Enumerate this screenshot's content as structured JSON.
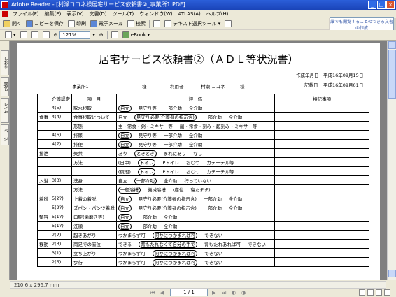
{
  "window": {
    "title": "Adobe Reader - [村瀬ココネ様居宅サービス依頼書②_事業所1.PDF]",
    "min": "_",
    "max": "□",
    "close": "×"
  },
  "menu": [
    "ファイル(F)",
    "編集(E)",
    "表示(V)",
    "文書(D)",
    "ツール(T)",
    "ウィンドウ(W)",
    "ATLAS(A)",
    "ヘルプ(H)"
  ],
  "toolbar1": {
    "open": "開く",
    "save_copy": "コピーを保存",
    "print": "印刷",
    "email": "電子メール",
    "search": "検索",
    "text_select": "テキスト選択ツール"
  },
  "help_box": "誰でも閲覧することのできる文書の作成",
  "toolbar2": {
    "zoom": "121%",
    "ebook": "eBook"
  },
  "nav_tabs": [
    "しおり",
    "署名",
    "レイヤー",
    "ページ"
  ],
  "status": {
    "page_size": "210.6 x 296.7 mm",
    "page_display": "1 / 1"
  },
  "document": {
    "title": "居宅サービス依頼書②（ＡＤＬ等状況書）",
    "created_label": "作成年月日",
    "created_date": "平成16年09月15日",
    "recorded_label": "記載日",
    "recorded_date": "平成16年09月01日",
    "office": "事業所1",
    "sama1": "様",
    "user_label": "利用者",
    "user_name": "村瀬 ココネ",
    "sama2": "様",
    "headers": {
      "cert": "介護認定",
      "item": "項　目",
      "eval": "評　価",
      "notes": "特記事項"
    },
    "rows": [
      {
        "cat": "",
        "cert": "4(5)",
        "item": "飲水摂取",
        "vals": [
          "自立",
          "見守り等",
          "一部介助",
          "全介助"
        ],
        "sel": 0
      },
      {
        "cat": "食事",
        "cert": "4(4)",
        "item": "食事摂取について",
        "vals": [
          "自立",
          "見守り必要(介護者の指示含)",
          "一部介助",
          "全介助"
        ],
        "sel": 1
      },
      {
        "cat": "",
        "cert": "",
        "item": "形態",
        "vals": [
          "主・常食・粥・ミキサー等",
          "副・常食・刻み・超刻み・ミキサー等"
        ],
        "sel": -1
      },
      {
        "cat": "",
        "cert": "4(6)",
        "item": "排尿",
        "vals": [
          "自立",
          "見守り等",
          "一部介助",
          "全介助"
        ],
        "sel": 0
      },
      {
        "cat": "",
        "cert": "4(7)",
        "item": "排便",
        "vals": [
          "自立",
          "見守り等",
          "一部介助",
          "全介助"
        ],
        "sel": 0
      },
      {
        "cat": "排泄",
        "cert": "",
        "item": "失禁",
        "vals": [
          "あり",
          "ときどき",
          "まれにあり",
          "なし"
        ],
        "sel": 1
      },
      {
        "cat": "",
        "cert": "",
        "item": "方法",
        "vals": [
          "(日中)",
          "トイレ",
          "Pトイレ",
          "おむつ",
          "カテーテル等"
        ],
        "sel": 1
      },
      {
        "cat": "",
        "cert": "",
        "item": "",
        "vals": [
          "(夜間)",
          "トイレ",
          "Pトイレ",
          "おむつ",
          "カテーテル等"
        ],
        "sel": 1
      },
      {
        "cat": "入浴",
        "cert": "3(3)",
        "item": "洗身",
        "vals": [
          "自立",
          "一部介助",
          "全介助",
          "行っていない"
        ],
        "sel": 1
      },
      {
        "cat": "",
        "cert": "",
        "item": "方法",
        "vals": [
          "一般浴槽",
          "機械浴槽",
          "(座位",
          "寝たまま)"
        ],
        "sel": 0
      },
      {
        "cat": "着脱",
        "cert": "5(2?)",
        "item": "上着の着脱",
        "vals": [
          "自立",
          "見守り必要(介護者の指示含)",
          "一部介助",
          "全介助"
        ],
        "sel": 0
      },
      {
        "cat": "",
        "cert": "5(2?)",
        "item": "ズボン・パンツ着脱",
        "vals": [
          "自立",
          "見守り必要(介護者の指示含)",
          "一部介助",
          "全介助"
        ],
        "sel": 0
      },
      {
        "cat": "整容",
        "cert": "5(1?)",
        "item": "口腔(歯磨き等)",
        "vals": [
          "自立",
          "一部介助",
          "全介助"
        ],
        "sel": 0
      },
      {
        "cat": "",
        "cert": "5(1?)",
        "item": "洗顔",
        "vals": [
          "自立",
          "一部介助",
          "全介助"
        ],
        "sel": 0
      },
      {
        "cat": "",
        "cert": "2(2)",
        "item": "起きあがり",
        "vals": [
          "つかまらず可",
          "何かにつかまれば可",
          "できない"
        ],
        "sel": 1
      },
      {
        "cat": "移動",
        "cert": "2(3)",
        "item": "両足での座位",
        "vals": [
          "できる",
          "背もたれなくて自分の手で",
          "背もたれあれば可",
          "できない"
        ],
        "sel": 1
      },
      {
        "cat": "",
        "cert": "3(1)",
        "item": "立ち上がり",
        "vals": [
          "つかまらず可",
          "何かにつかまれば可",
          "できない"
        ],
        "sel": 1
      },
      {
        "cat": "",
        "cert": "2(5)",
        "item": "歩行",
        "vals": [
          "つかまらず可",
          "何かにつかまれば可",
          "できない"
        ],
        "sel": 1
      }
    ]
  }
}
